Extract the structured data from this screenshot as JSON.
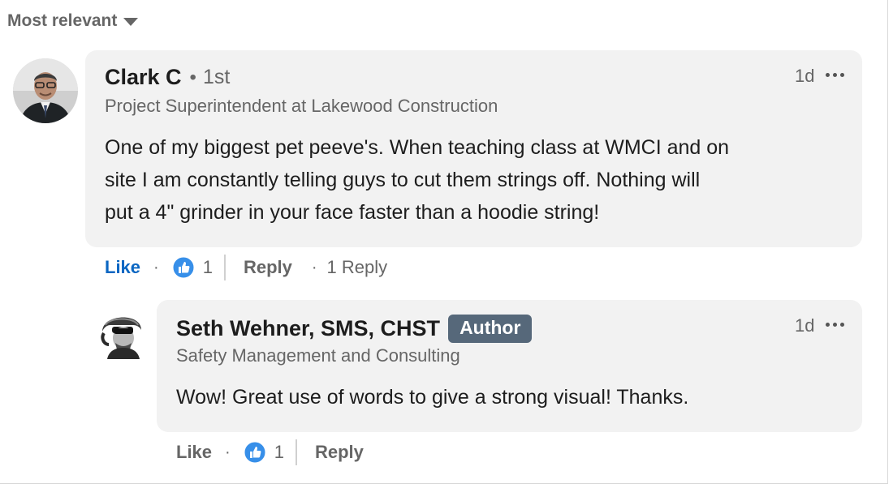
{
  "sort": {
    "label": "Most relevant"
  },
  "comments": [
    {
      "name": "Clark C",
      "degree": "1st",
      "headline": "Project Superintendent at Lakewood Construction",
      "time": "1d",
      "lines": [
        "One of my biggest pet peeve's. When teaching class at WMCI and on",
        "site I am constantly telling guys to cut them strings off. Nothing will",
        "put a 4\" grinder in your face faster than a hoodie string!"
      ],
      "like_label": "Like",
      "like_count": "1",
      "reply_label": "Reply",
      "replies_label": "1 Reply",
      "like_color": "#0a66c2"
    },
    {
      "name": "Seth Wehner, SMS, CHST",
      "badge": "Author",
      "headline": "Safety Management and Consulting",
      "time": "1d",
      "lines": [
        "Wow! Great use of words to give a strong visual! Thanks."
      ],
      "like_label": "Like",
      "like_count": "1",
      "reply_label": "Reply",
      "like_color": "#666666"
    }
  ],
  "colors": {
    "bubble": "#f2f2f2",
    "secondary_text": "#666666",
    "author_badge": "#56687a",
    "like_reaction": "#378fe9"
  }
}
